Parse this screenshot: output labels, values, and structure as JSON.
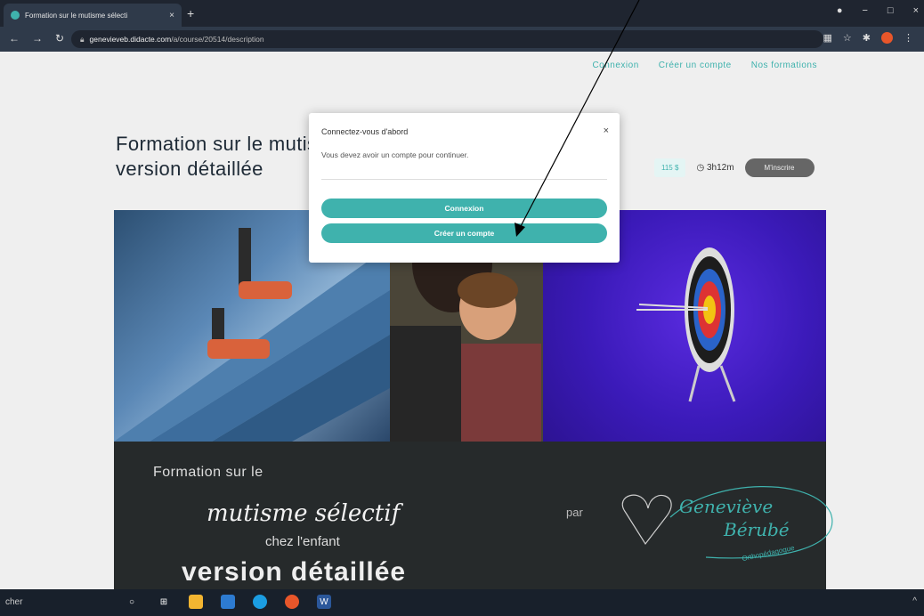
{
  "browser": {
    "tab_title": "Formation sur le mutisme sélecti",
    "tab_close": "×",
    "new_tab": "+",
    "url_host": "genevieveb.didacte.com",
    "url_path": "/a/course/20514/description",
    "window_controls": {
      "minimize": "−",
      "maximize": "□",
      "close": "×"
    }
  },
  "site_nav": {
    "login": "Connexion",
    "signup": "Créer un compte",
    "courses": "Nos formations"
  },
  "course": {
    "title": "Formation sur le mutisme sélectif version détaillée",
    "price": "115 $",
    "duration": "3h12m",
    "enroll": "M'inscrire"
  },
  "banner": {
    "line1": "Formation sur le",
    "line2": "mutisme sélectif",
    "line3": "chez l'enfant",
    "line4": "version détaillée",
    "par": "par",
    "logo_name1": "Geneviève",
    "logo_name2": "Bérubé",
    "logo_sub": "Orthopédagogue"
  },
  "modal": {
    "title": "Connectez-vous d'abord",
    "close": "×",
    "message": "Vous devez avoir un compte pour continuer.",
    "login_button": "Connexion",
    "register_button": "Créer un compte"
  },
  "taskbar": {
    "search_text": "cher",
    "tray_chevron": "^"
  },
  "colors": {
    "accent": "#3fb2ad",
    "chrome": "#2f3a4a"
  }
}
